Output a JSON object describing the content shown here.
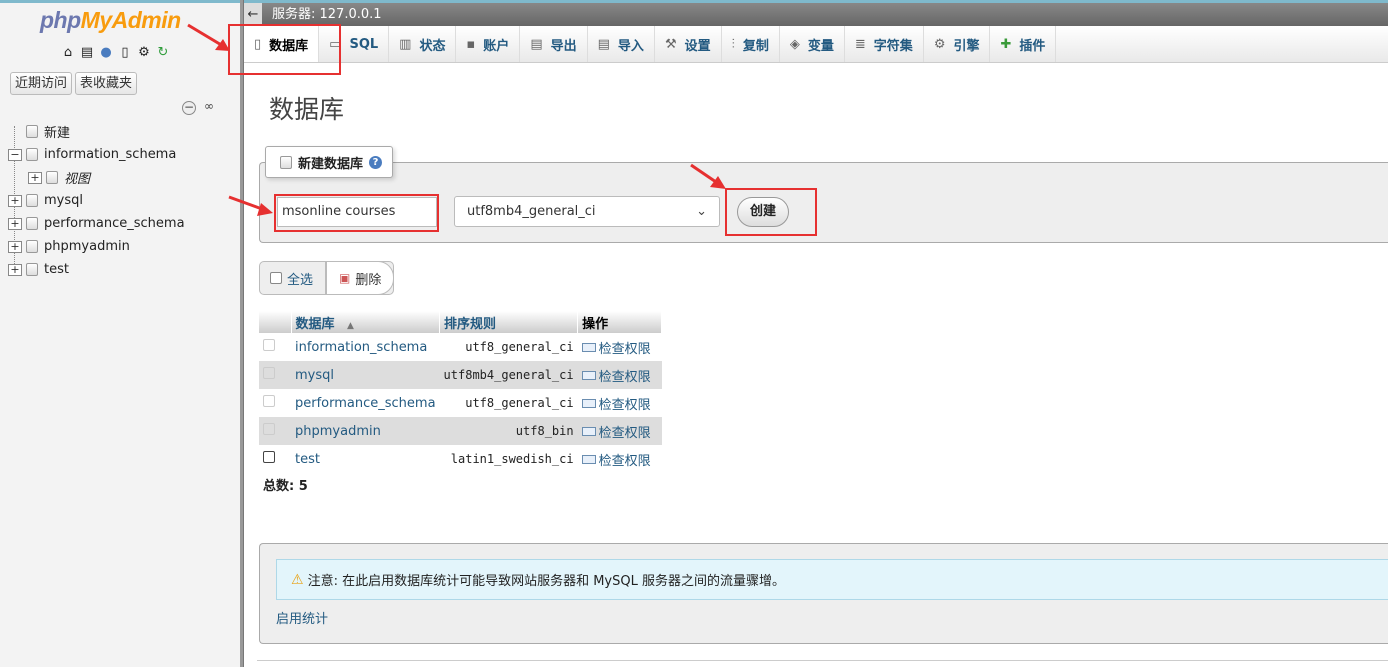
{
  "sidebar": {
    "logo_php": "php",
    "logo_myadmin": "MyAdmin",
    "recent_label": "近期访问",
    "favorites_label": "表收藏夹",
    "tree": [
      {
        "label": "新建",
        "italic": false
      },
      {
        "label": "information_schema",
        "italic": false
      },
      {
        "label": "视图",
        "italic": true
      },
      {
        "label": "mysql",
        "italic": false
      },
      {
        "label": "performance_schema",
        "italic": false
      },
      {
        "label": "phpmyadmin",
        "italic": false
      },
      {
        "label": "test",
        "italic": false
      }
    ]
  },
  "header": {
    "back": "←",
    "server_label": "服务器: 127.0.0.1"
  },
  "tabs": [
    {
      "label": "数据库",
      "icon": "database-icon"
    },
    {
      "label": "SQL",
      "icon": "sql-icon"
    },
    {
      "label": "状态",
      "icon": "status-icon"
    },
    {
      "label": "账户",
      "icon": "accounts-icon"
    },
    {
      "label": "导出",
      "icon": "export-icon"
    },
    {
      "label": "导入",
      "icon": "import-icon"
    },
    {
      "label": "设置",
      "icon": "settings-icon"
    },
    {
      "label": "复制",
      "icon": "replication-icon"
    },
    {
      "label": "变量",
      "icon": "variables-icon"
    },
    {
      "label": "字符集",
      "icon": "charset-icon"
    },
    {
      "label": "引擎",
      "icon": "engines-icon"
    },
    {
      "label": "插件",
      "icon": "plugins-icon"
    }
  ],
  "main": {
    "title": "数据库",
    "create": {
      "legend": "新建数据库",
      "db_name_value": "msonline courses",
      "collation_value": "utf8mb4_general_ci",
      "create_button": "创建"
    },
    "bulk": {
      "select_all": "全选",
      "delete": "删除"
    },
    "table": {
      "headers": [
        "数据库",
        "排序规则",
        "操作"
      ],
      "rows": [
        {
          "name": "information_schema",
          "collation": "utf8_general_ci",
          "action": "检查权限"
        },
        {
          "name": "mysql",
          "collation": "utf8mb4_general_ci",
          "action": "检查权限"
        },
        {
          "name": "performance_schema",
          "collation": "utf8_general_ci",
          "action": "检查权限"
        },
        {
          "name": "phpmyadmin",
          "collation": "utf8_bin",
          "action": "检查权限"
        },
        {
          "name": "test",
          "collation": "latin1_swedish_ci",
          "action": "检查权限"
        }
      ],
      "total_label": "总数:",
      "total_value": "5"
    },
    "notice": {
      "text": "注意: 在此启用数据库统计可能导致网站服务器和 MySQL 服务器之间的流量骤增。",
      "enable_link": "启用统计"
    }
  },
  "colors": {
    "link": "#235a81",
    "annotation_red": "#e63030",
    "logo_php": "#6c78af",
    "logo_myadmin": "#f89c0e"
  }
}
